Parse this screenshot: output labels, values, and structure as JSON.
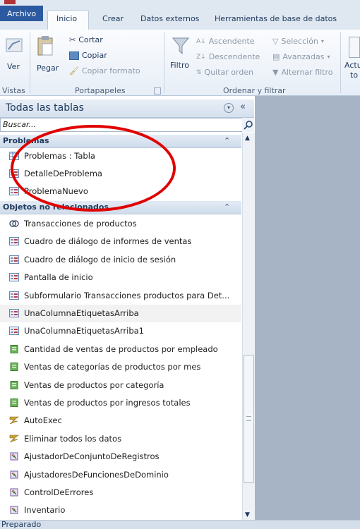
{
  "tabs": {
    "file": "Archivo",
    "items": [
      "Inicio",
      "Crear",
      "Datos externos",
      "Herramientas de base de datos"
    ]
  },
  "ribbon": {
    "vistas": {
      "ver": "Ver",
      "group": "Vistas"
    },
    "portapapeles": {
      "pegar": "Pegar",
      "cortar": "Cortar",
      "copiar": "Copiar",
      "copiar_formato": "Copiar formato",
      "group": "Portapapeles"
    },
    "ordenar": {
      "filtro": "Filtro",
      "ascendente": "Ascendente",
      "descendente": "Descendente",
      "quitar_orden": "Quitar orden",
      "seleccion": "Selección",
      "avanzadas": "Avanzadas",
      "alternar_filtro": "Alternar filtro",
      "group": "Ordenar y filtrar"
    },
    "actualizar": {
      "line1": "Actu",
      "line2": "to"
    }
  },
  "nav": {
    "title": "Todas las tablas",
    "search_placeholder": "Buscar...",
    "groups": [
      {
        "label": "Problemas",
        "items": [
          {
            "label": "Problemas : Tabla",
            "icon": "table-icon"
          },
          {
            "label": "DetalleDeProblema",
            "icon": "form-icon"
          },
          {
            "label": "ProblemaNuevo",
            "icon": "form-icon"
          }
        ]
      },
      {
        "label": "Objetos no relacionados",
        "items": [
          {
            "label": "Transacciones de productos",
            "icon": "query-icon"
          },
          {
            "label": "Cuadro de diálogo de informes de ventas",
            "icon": "form-icon"
          },
          {
            "label": "Cuadro de diálogo de inicio de sesión",
            "icon": "form-icon"
          },
          {
            "label": "Pantalla de inicio",
            "icon": "form-icon"
          },
          {
            "label": "Subformulario Transacciones productos para Det...",
            "icon": "form-icon"
          },
          {
            "label": "UnaColumnaEtiquetasArriba",
            "icon": "form-icon"
          },
          {
            "label": "UnaColumnaEtiquetasArriba1",
            "icon": "form-icon"
          },
          {
            "label": "Cantidad de ventas de productos por empleado",
            "icon": "report-icon"
          },
          {
            "label": "Ventas de categorías de productos por mes",
            "icon": "report-icon"
          },
          {
            "label": "Ventas de productos por categoría",
            "icon": "report-icon"
          },
          {
            "label": "Ventas de productos por ingresos totales",
            "icon": "report-icon"
          },
          {
            "label": "AutoExec",
            "icon": "macro-icon"
          },
          {
            "label": "Eliminar todos los datos",
            "icon": "macro-icon"
          },
          {
            "label": "AjustadorDeConjuntoDeRegistros",
            "icon": "module-icon"
          },
          {
            "label": "AjustadoresDeFuncionesDeDominio",
            "icon": "module-icon"
          },
          {
            "label": "ControlDeErrores",
            "icon": "module-icon"
          },
          {
            "label": "Inventario",
            "icon": "module-icon"
          }
        ]
      }
    ]
  },
  "status": "Preparado",
  "colors": {
    "file_tab": "#2c5aa0",
    "annotation": "#e00000",
    "workspace": "#a6b4c6"
  }
}
